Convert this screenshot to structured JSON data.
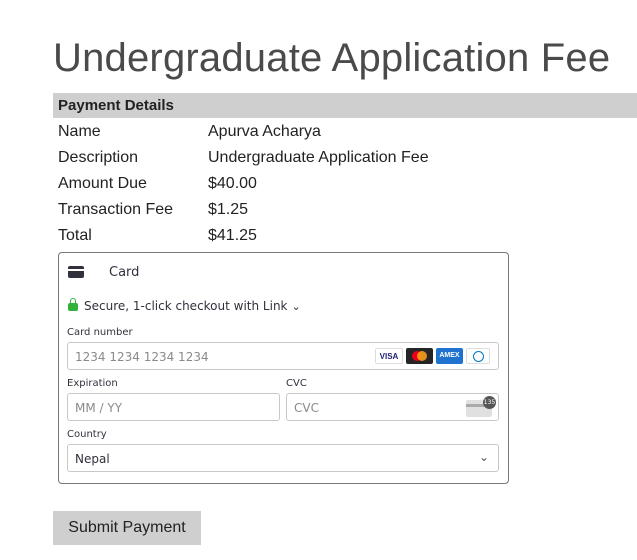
{
  "page": {
    "title": "Undergraduate Application Fee"
  },
  "details": {
    "heading": "Payment Details",
    "rows": [
      {
        "label": "Name",
        "value": "Apurva Acharya"
      },
      {
        "label": "Description",
        "value": "Undergraduate Application Fee"
      },
      {
        "label": "Amount Due",
        "value": "$40.00"
      },
      {
        "label": "Transaction Fee",
        "value": "$1.25"
      },
      {
        "label": "Total",
        "value": "$41.25"
      }
    ]
  },
  "card": {
    "tab_label": "Card",
    "link_text": "Secure, 1-click checkout with Link",
    "card_number_label": "Card number",
    "card_number_placeholder": "1234 1234 1234 1234",
    "brands": [
      "VISA",
      "Mastercard",
      "AMEX",
      "Diners"
    ],
    "expiration_label": "Expiration",
    "expiration_placeholder": "MM / YY",
    "cvc_label": "CVC",
    "cvc_placeholder": "CVC",
    "cvc_badge": "135",
    "country_label": "Country",
    "country_value": "Nepal"
  },
  "actions": {
    "submit_label": "Submit Payment"
  },
  "colors": {
    "secure_lock": "#33b13d",
    "bar": "#cfcfcf",
    "title": "#4a4a4a"
  },
  "icons": {
    "card": "credit-card-icon",
    "lock": "lock-icon",
    "chevron": "chevron-down-icon",
    "cvc": "cvc-card-icon"
  }
}
